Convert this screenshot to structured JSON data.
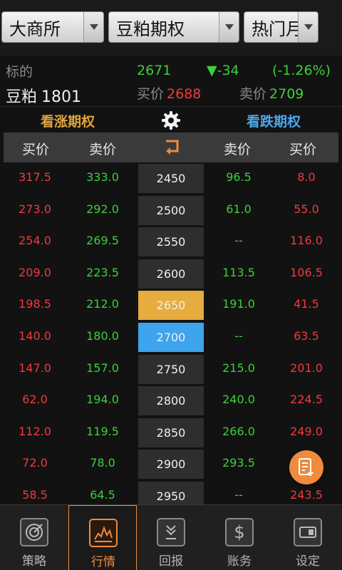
{
  "selectors": {
    "exchange": "大商所",
    "product": "豆粕期权",
    "hot": "热门月"
  },
  "underlying": {
    "label": "标的",
    "name": "豆粕",
    "contract": "1801",
    "price": "2671",
    "change": "▼-34",
    "pct": "(-1.26%)",
    "bid_label": "买价",
    "bid": "2688",
    "ask_label": "卖价",
    "ask": "2709"
  },
  "headings": {
    "call": "看涨期权",
    "put": "看跌期权"
  },
  "columns": {
    "call_bid": "买价",
    "call_ask": "卖价",
    "put_ask": "卖价",
    "put_bid": "买价"
  },
  "rows": [
    {
      "cb": "317.5",
      "ca": "333.0",
      "strike": "2450",
      "pa": "96.5",
      "pb": "8.0",
      "hl": ""
    },
    {
      "cb": "273.0",
      "ca": "292.0",
      "strike": "2500",
      "pa": "61.0",
      "pb": "55.0",
      "hl": ""
    },
    {
      "cb": "254.0",
      "ca": "269.5",
      "strike": "2550",
      "pa": "--",
      "pb": "116.0",
      "hl": ""
    },
    {
      "cb": "209.0",
      "ca": "223.5",
      "strike": "2600",
      "pa": "113.5",
      "pb": "106.5",
      "hl": ""
    },
    {
      "cb": "198.5",
      "ca": "212.0",
      "strike": "2650",
      "pa": "191.0",
      "pb": "41.5",
      "hl": "call"
    },
    {
      "cb": "140.0",
      "ca": "180.0",
      "strike": "2700",
      "pa": "--",
      "pb": "63.5",
      "hl": "put"
    },
    {
      "cb": "147.0",
      "ca": "157.0",
      "strike": "2750",
      "pa": "215.0",
      "pb": "201.0",
      "hl": ""
    },
    {
      "cb": "62.0",
      "ca": "194.0",
      "strike": "2800",
      "pa": "240.0",
      "pb": "224.5",
      "hl": ""
    },
    {
      "cb": "112.0",
      "ca": "119.5",
      "strike": "2850",
      "pa": "266.0",
      "pb": "249.0",
      "hl": ""
    },
    {
      "cb": "72.0",
      "ca": "78.0",
      "strike": "2900",
      "pa": "293.5",
      "pb": "",
      "hl": ""
    },
    {
      "cb": "58.5",
      "ca": "64.5",
      "strike": "2950",
      "pa": "--",
      "pb": "243.5",
      "hl": ""
    }
  ],
  "nav": [
    {
      "label": "策略",
      "icon": "target-icon",
      "active": false
    },
    {
      "label": "行情",
      "icon": "chart-icon",
      "active": true
    },
    {
      "label": "回报",
      "icon": "arrows-down-icon",
      "active": false
    },
    {
      "label": "账务",
      "icon": "dollar-icon",
      "active": false
    },
    {
      "label": "设定",
      "icon": "settings-card-icon",
      "active": false
    }
  ],
  "colors": {
    "accent": "#f08a3c",
    "up": "#ee3b3b",
    "down": "#3ad13a",
    "call_heading": "#e0a53a",
    "put_heading": "#4aa8e8"
  }
}
